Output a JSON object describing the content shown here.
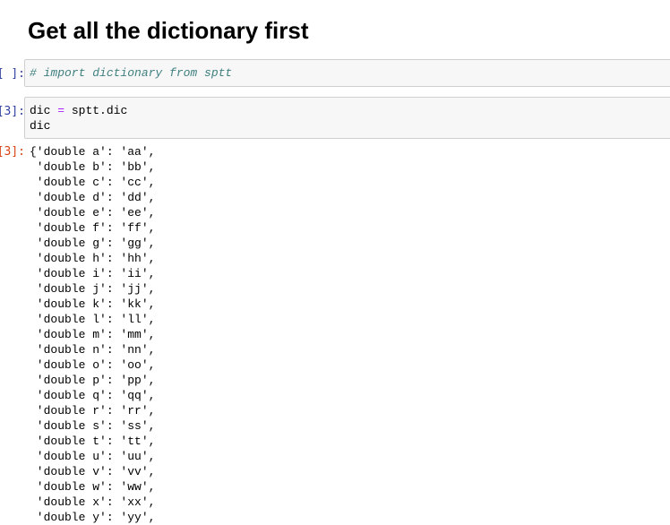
{
  "heading": "Get all the dictionary first",
  "cells": [
    {
      "prompt": "[ ]:",
      "comment": "# import dictionary from sptt"
    },
    {
      "prompt": "[3]:",
      "code_var": "dic",
      "code_op": "=",
      "code_expr": "sptt.dic",
      "code_line2": "dic"
    }
  ],
  "output": {
    "prompt": "[3]:",
    "lines": [
      "{'double a': 'aa',",
      " 'double b': 'bb',",
      " 'double c': 'cc',",
      " 'double d': 'dd',",
      " 'double e': 'ee',",
      " 'double f': 'ff',",
      " 'double g': 'gg',",
      " 'double h': 'hh',",
      " 'double i': 'ii',",
      " 'double j': 'jj',",
      " 'double k': 'kk',",
      " 'double l': 'll',",
      " 'double m': 'mm',",
      " 'double n': 'nn',",
      " 'double o': 'oo',",
      " 'double p': 'pp',",
      " 'double q': 'qq',",
      " 'double r': 'rr',",
      " 'double s': 'ss',",
      " 'double t': 'tt',",
      " 'double u': 'uu',",
      " 'double v': 'vv',",
      " 'double w': 'ww',",
      " 'double x': 'xx',",
      " 'double y': 'yy',"
    ]
  }
}
